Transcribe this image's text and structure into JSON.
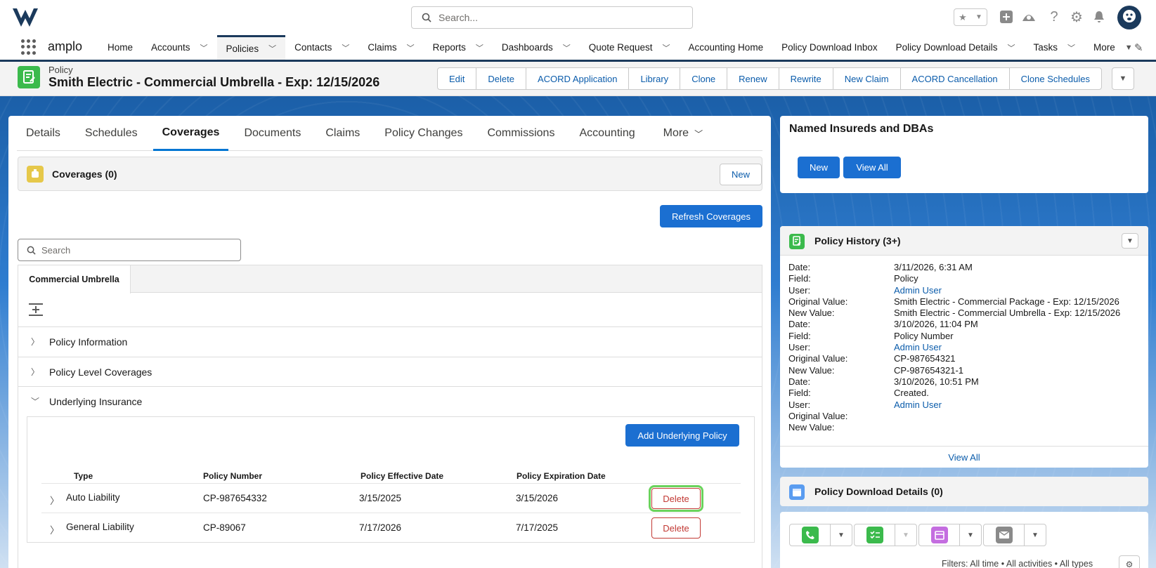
{
  "header": {
    "search_placeholder": "Search...",
    "app_name": "amplo"
  },
  "nav": {
    "items": [
      {
        "label": "Home",
        "dropdown": false
      },
      {
        "label": "Accounts",
        "dropdown": true
      },
      {
        "label": "Policies",
        "dropdown": true,
        "active": true
      },
      {
        "label": "Contacts",
        "dropdown": true
      },
      {
        "label": "Claims",
        "dropdown": true
      },
      {
        "label": "Reports",
        "dropdown": true
      },
      {
        "label": "Dashboards",
        "dropdown": true
      },
      {
        "label": "Quote Request",
        "dropdown": true
      },
      {
        "label": "Accounting Home",
        "dropdown": false
      },
      {
        "label": "Policy Download Inbox",
        "dropdown": false
      },
      {
        "label": "Policy Download Details",
        "dropdown": true
      },
      {
        "label": "Tasks",
        "dropdown": true
      },
      {
        "label": "More",
        "dropdown": true
      }
    ]
  },
  "record": {
    "type": "Policy",
    "title": "Smith Electric - Commercial Umbrella - Exp: 12/15/2026",
    "actions": [
      "Edit",
      "Delete",
      "ACORD Application",
      "Library",
      "Clone",
      "Renew",
      "Rewrite",
      "New Claim",
      "ACORD Cancellation",
      "Clone Schedules"
    ]
  },
  "tabs": {
    "items": [
      "Details",
      "Schedules",
      "Coverages",
      "Documents",
      "Claims",
      "Policy Changes",
      "Commissions",
      "Accounting"
    ],
    "active": "Coverages",
    "more": "More"
  },
  "coverages": {
    "title": "Coverages (0)",
    "new_label": "New",
    "refresh_label": "Refresh Coverages",
    "search_placeholder": "Search",
    "subtab": "Commercial Umbrella",
    "sections": [
      "Policy Information",
      "Policy Level Coverages",
      "Underlying Insurance"
    ],
    "add_underlying_label": "Add Underlying Policy",
    "columns": [
      "Type",
      "Policy Number",
      "Policy Effective Date",
      "Policy Expiration Date"
    ],
    "rows": [
      {
        "type": "Auto Liability",
        "policy_number": "CP-987654332",
        "effective": "3/15/2025",
        "expiration": "3/15/2026",
        "action": "Delete"
      },
      {
        "type": "General Liability",
        "policy_number": "CP-89067",
        "effective": "7/17/2026",
        "expiration": "7/17/2025",
        "action": "Delete"
      }
    ]
  },
  "named_insureds": {
    "title": "Named Insureds and DBAs",
    "new_label": "New",
    "view_all_label": "View All"
  },
  "history": {
    "title": "Policy History (3+)",
    "labels": {
      "date": "Date:",
      "field": "Field:",
      "user": "User:",
      "orig": "Original Value:",
      "newv": "New Value:"
    },
    "entries": [
      {
        "date": "3/11/2026, 6:31 AM",
        "field": "Policy",
        "user": "Admin User",
        "orig": "Smith Electric - Commercial Package - Exp: 12/15/2026",
        "newv": "Smith Electric - Commercial Umbrella - Exp: 12/15/2026"
      },
      {
        "date": "3/10/2026, 11:04 PM",
        "field": "Policy Number",
        "user": "Admin User",
        "orig": "CP-987654321",
        "newv": "CP-987654321-1"
      },
      {
        "date": "3/10/2026, 10:51 PM",
        "field": "Created.",
        "user": "Admin User",
        "orig": "",
        "newv": ""
      }
    ],
    "view_all": "View All"
  },
  "download_details": {
    "title": "Policy Download Details (0)"
  },
  "activity": {
    "filters": "Filters: All time • All activities • All types"
  },
  "colors": {
    "brand": "#0b5cab",
    "nav_border": "#1b3a5c",
    "delete": "#c23934",
    "highlight": "#6ad35c"
  }
}
